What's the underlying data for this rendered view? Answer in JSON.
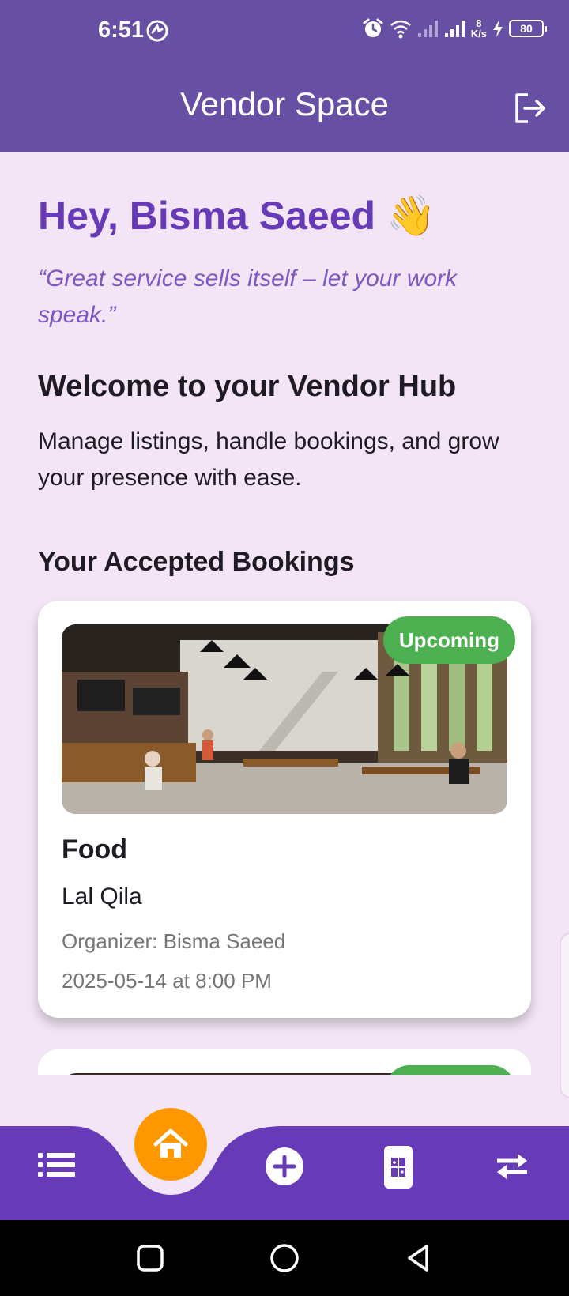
{
  "status_bar": {
    "time": "6:51",
    "net_speed_value": "8",
    "net_speed_unit": "K/s",
    "battery": "80"
  },
  "app_bar": {
    "title": "Vendor Space",
    "logout_icon": "logout-icon"
  },
  "hero": {
    "greeting": "Hey, Bisma Saeed 👋",
    "quote": "“Great service sells itself – let your work speak.”"
  },
  "welcome": {
    "title": "Welcome to your Vendor Hub",
    "description": "Manage listings, handle bookings, and grow your presence with ease."
  },
  "bookings": {
    "section_title": "Your Accepted Bookings",
    "items": [
      {
        "status": "Upcoming",
        "title": "Food",
        "venue": "Lal Qila",
        "organizer": "Organizer: Bisma Saeed",
        "datetime": "2025-05-14 at 8:00 PM",
        "image": "cafe-interior-photo"
      }
    ]
  },
  "bottom_nav": {
    "items": [
      "list-icon",
      "home-icon",
      "add-circle-icon",
      "ticket-icon",
      "swap-icon"
    ],
    "active": "home-icon"
  },
  "colors": {
    "primary": "#6750a4",
    "nav": "#673ab7",
    "accent": "#ff9800",
    "badge": "#4caf50",
    "background": "#f3e5f5"
  }
}
